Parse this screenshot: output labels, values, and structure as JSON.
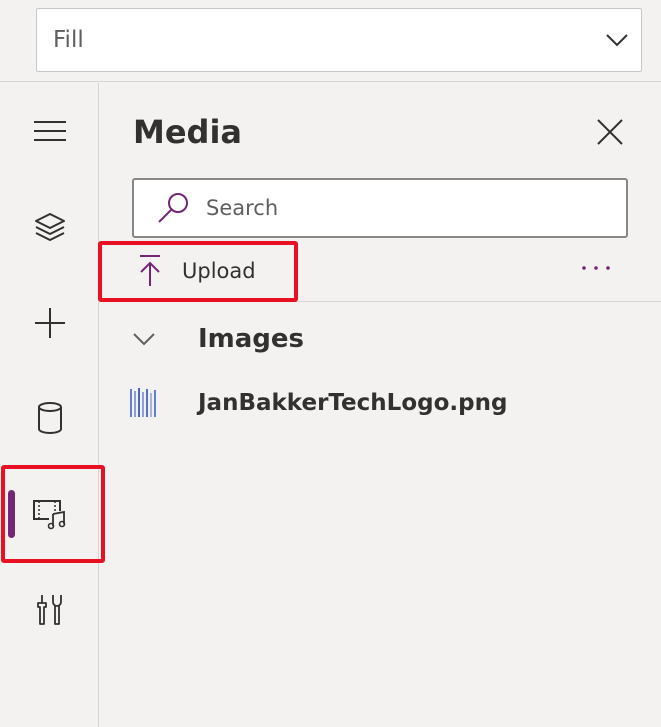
{
  "property_dropdown": {
    "value": "Fill"
  },
  "rail": {
    "items": [
      {
        "name": "menu",
        "icon": "hamburger-icon"
      },
      {
        "name": "tree-view",
        "icon": "layers-icon"
      },
      {
        "name": "insert",
        "icon": "plus-icon"
      },
      {
        "name": "data",
        "icon": "database-icon"
      },
      {
        "name": "media",
        "icon": "media-icon",
        "active": true
      },
      {
        "name": "advanced-tools",
        "icon": "tools-icon"
      }
    ],
    "accent_color": "#742774"
  },
  "media_pane": {
    "title": "Media",
    "search": {
      "placeholder": "Search",
      "value": ""
    },
    "upload_label": "Upload",
    "sections": [
      {
        "label": "Images",
        "expanded": true,
        "files": [
          {
            "name": "JanBakkerTechLogo.png"
          }
        ]
      }
    ]
  },
  "highlight_color": "#e81123"
}
